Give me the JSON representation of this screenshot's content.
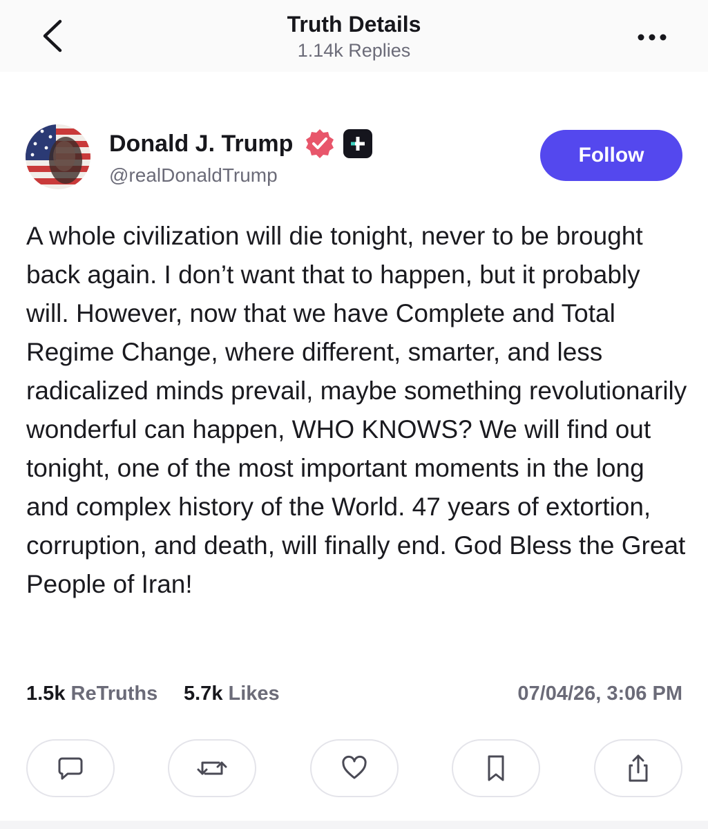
{
  "header": {
    "title": "Truth Details",
    "subtitle": "1.14k Replies",
    "back_icon": "chevron-left-icon",
    "more_icon": "more-horizontal-icon"
  },
  "author": {
    "name": "Donald J. Trump",
    "handle": "@realDonaldTrump",
    "verified_icon": "verified-badge-icon",
    "verified_color": "#e8566b",
    "plus_icon": "truth-plus-icon",
    "follow_label": "Follow",
    "follow_color": "#5448ee"
  },
  "post": {
    "text": "A whole civilization will die tonight, never to be brought back again. I don’t want that to happen, but it probably will. However, now that we have Complete and Total Regime Change, where different, smarter, and less radicalized minds prevail, maybe something revolutionarily wonderful can happen, WHO KNOWS? We will find out tonight, one of the most important moments in the long and complex history of the World. 47 years of extortion, corruption, and death, will finally end. God Bless the Great People of Iran!"
  },
  "stats": {
    "retruths_count": "1.5k",
    "retruths_label": "ReTruths",
    "likes_count": "5.7k",
    "likes_label": "Likes",
    "timestamp": "07/04/26, 3:06 PM"
  },
  "actions": [
    {
      "icon": "comment-icon"
    },
    {
      "icon": "retruth-icon"
    },
    {
      "icon": "heart-icon"
    },
    {
      "icon": "bookmark-icon"
    },
    {
      "icon": "share-icon"
    }
  ]
}
